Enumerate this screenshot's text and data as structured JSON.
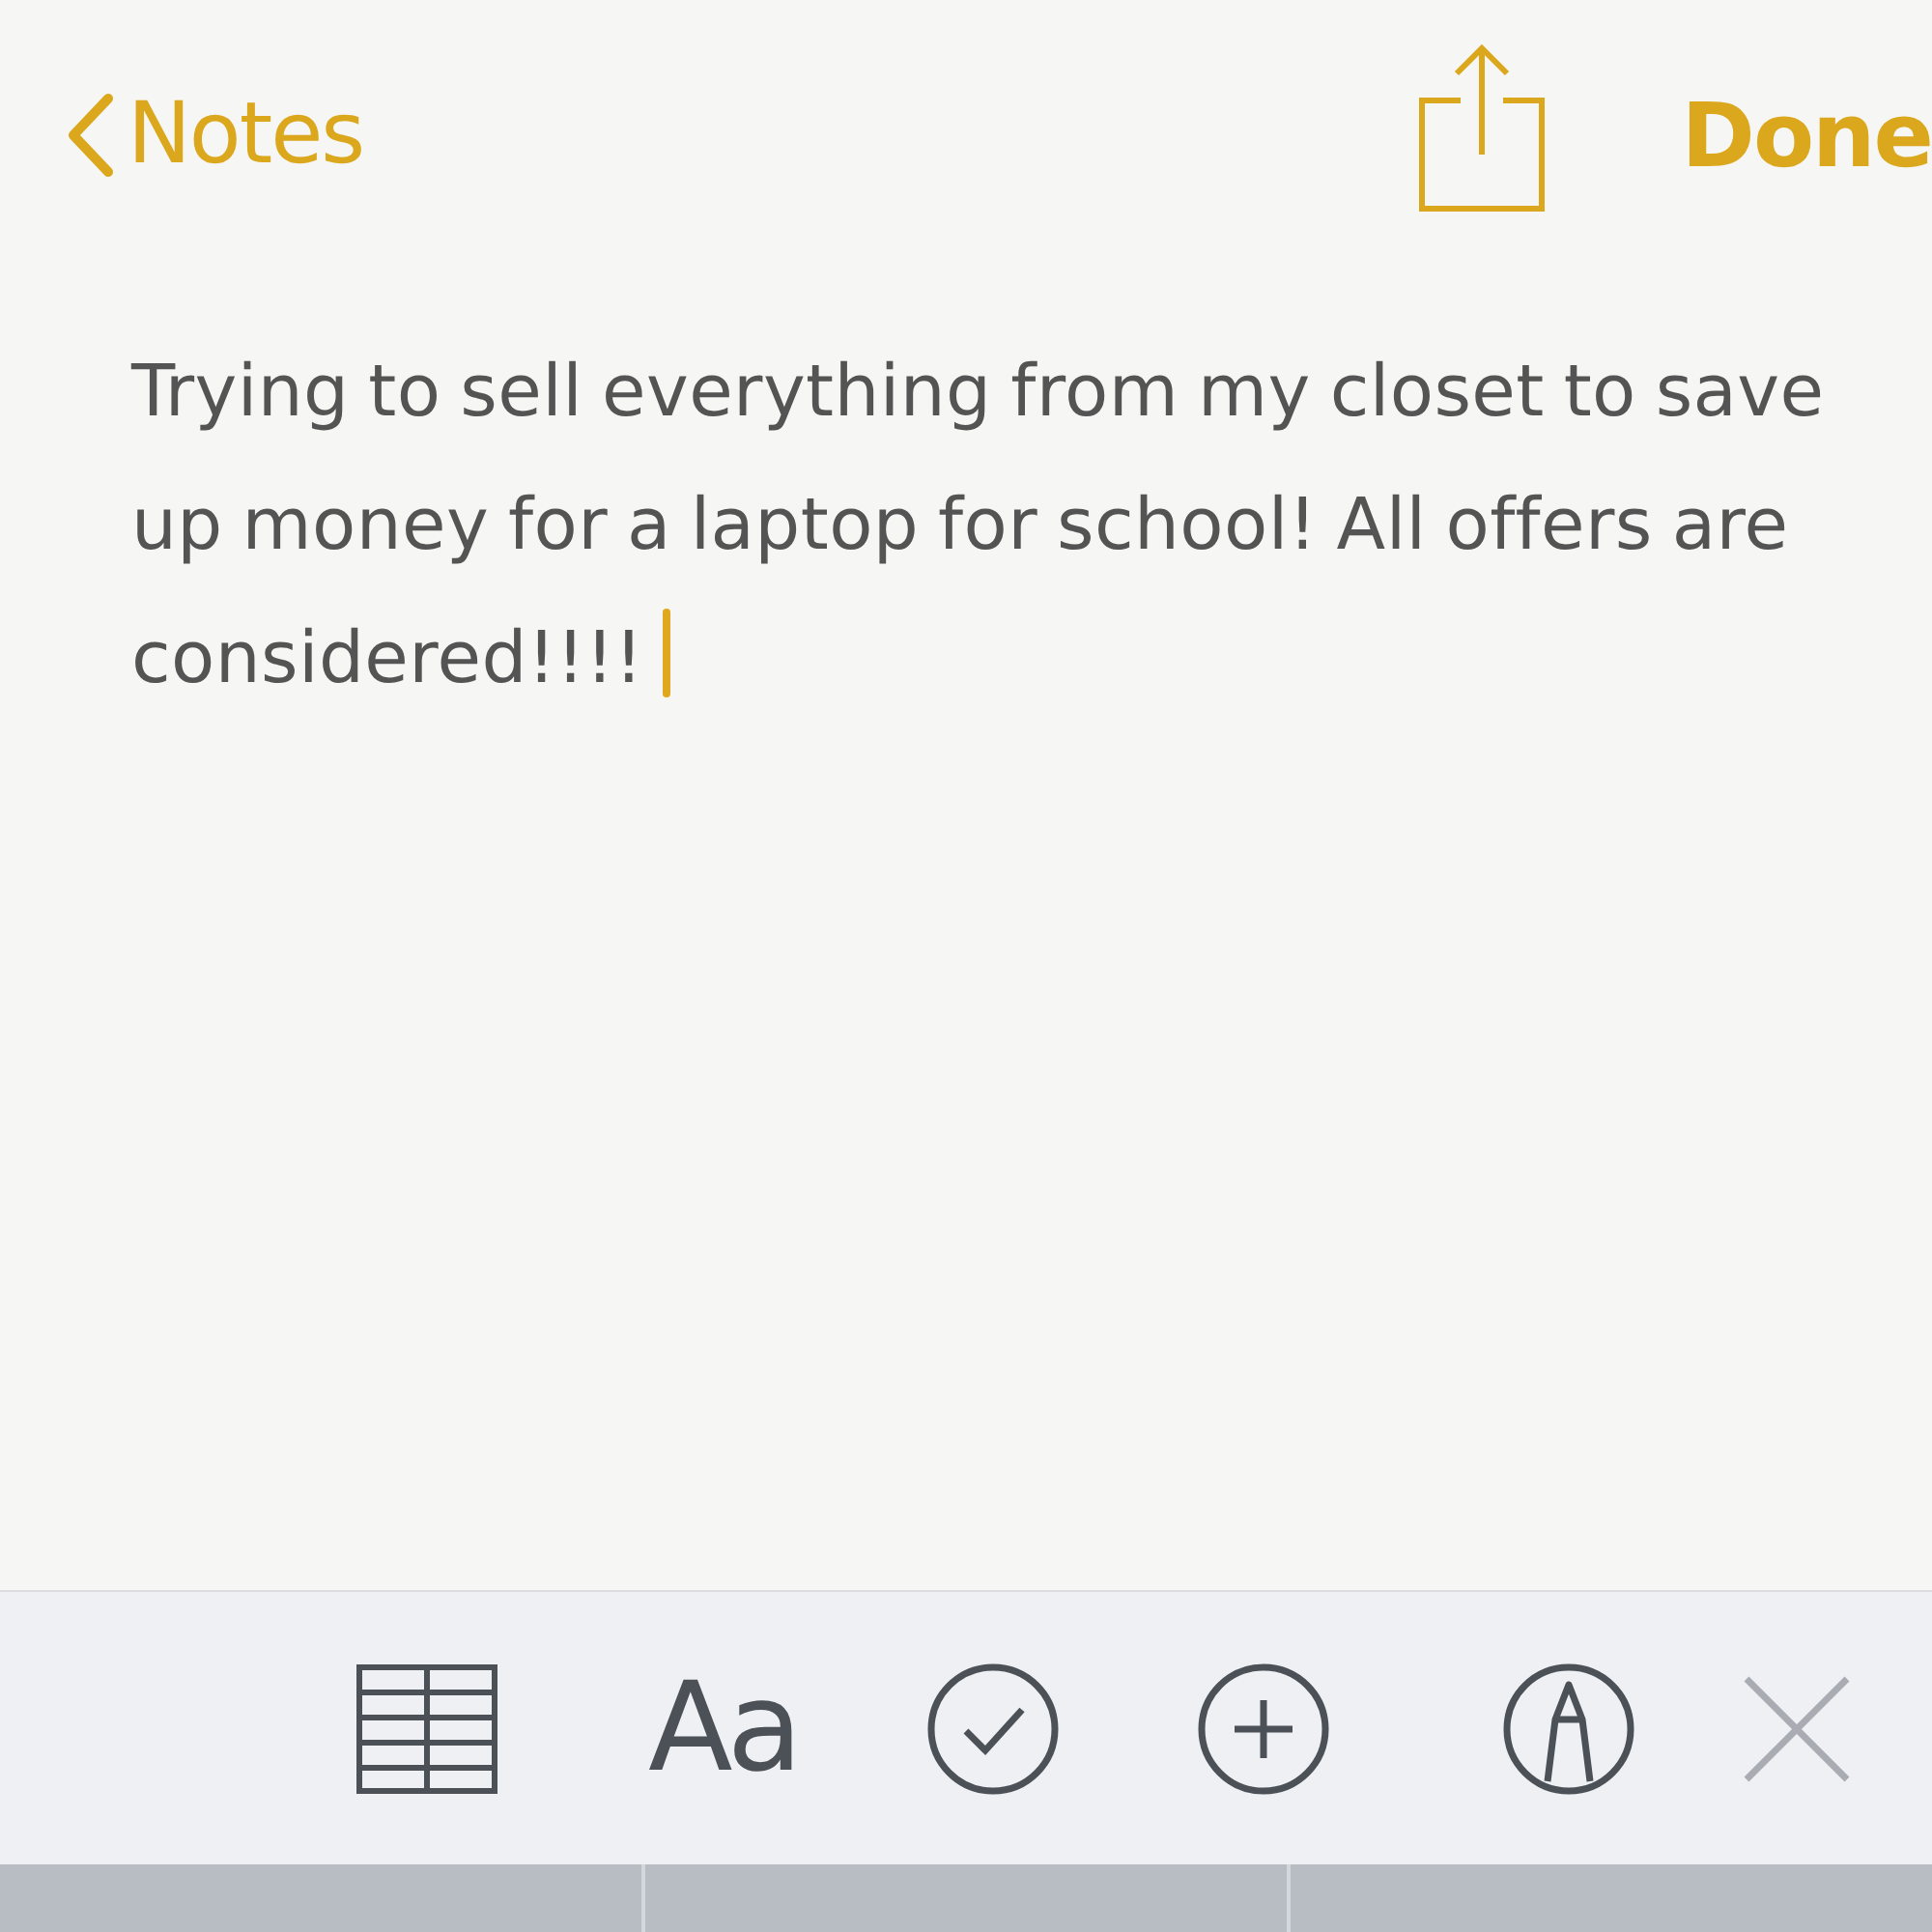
{
  "nav": {
    "back_label": "Notes",
    "done_label": "Done"
  },
  "note": {
    "text": "Trying to sell everything from my closet to save up money for a laptop for school! All offers are considered!!!!",
    "editing": true
  },
  "toolbar": [
    {
      "kind": "table",
      "disabled": false
    },
    {
      "kind": "format",
      "label": "Aa",
      "disabled": false
    },
    {
      "kind": "checklist",
      "disabled": false
    },
    {
      "kind": "add",
      "disabled": false
    },
    {
      "kind": "sketch",
      "disabled": false
    },
    {
      "kind": "close",
      "disabled": true
    }
  ]
}
